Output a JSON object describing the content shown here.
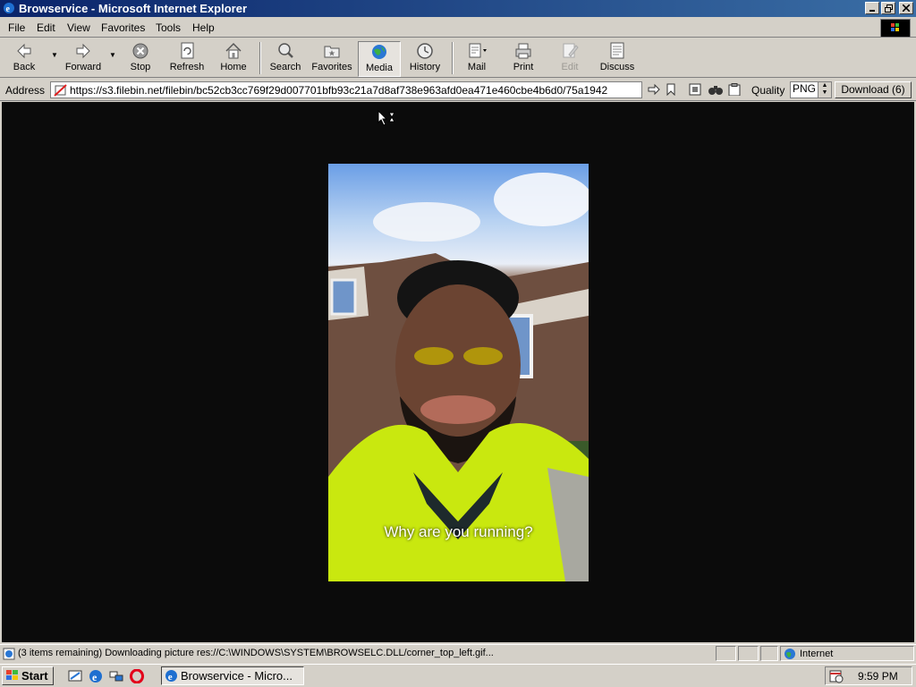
{
  "window": {
    "title": "Browservice - Microsoft Internet Explorer"
  },
  "menu": [
    "File",
    "Edit",
    "View",
    "Favorites",
    "Tools",
    "Help"
  ],
  "toolbar": {
    "back": "Back",
    "forward": "Forward",
    "stop": "Stop",
    "refresh": "Refresh",
    "home": "Home",
    "search": "Search",
    "favorites": "Favorites",
    "media": "Media",
    "history": "History",
    "mail": "Mail",
    "print": "Print",
    "edit": "Edit",
    "discuss": "Discuss"
  },
  "address": {
    "label": "Address",
    "url": "https://s3.filebin.net/filebin/bc52cb3cc769f29d007701bfb93c21a7d8af738e963afd0ea471e460cbe4b6d0/75a1942",
    "quality_label": "Quality",
    "quality_value": "PNG",
    "download_label": "Download (6)"
  },
  "content": {
    "caption": "Why are you running?"
  },
  "status": {
    "text": "(3 items remaining) Downloading picture res://C:\\WINDOWS\\SYSTEM\\BROWSELC.DLL/corner_top_left.gif...",
    "zone": "Internet"
  },
  "taskbar": {
    "start": "Start",
    "task": "Browservice - Micro...",
    "clock": "9:59 PM"
  }
}
